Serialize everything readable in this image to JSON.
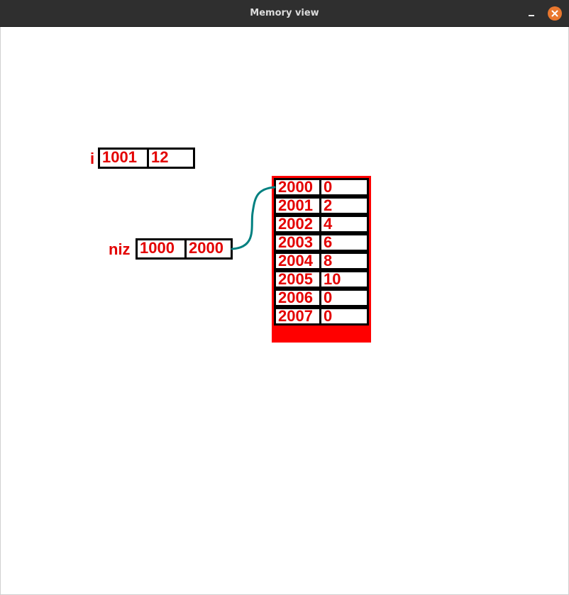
{
  "window": {
    "title": "Memory view",
    "minimize_icon": "minimize-icon",
    "close_icon": "close-icon",
    "close_color": "#e9772e"
  },
  "variables": {
    "i": {
      "name": "i",
      "address": "1001",
      "value": "12"
    },
    "niz": {
      "name": "niz",
      "address": "1000",
      "value": "2000"
    }
  },
  "array": {
    "rows": [
      {
        "address": "2000",
        "value": "0"
      },
      {
        "address": "2001",
        "value": "2"
      },
      {
        "address": "2002",
        "value": "4"
      },
      {
        "address": "2003",
        "value": "6"
      },
      {
        "address": "2004",
        "value": "8"
      },
      {
        "address": "2005",
        "value": "10"
      },
      {
        "address": "2006",
        "value": "0"
      },
      {
        "address": "2007",
        "value": "0"
      }
    ]
  },
  "colors": {
    "text": "#e30000",
    "block": "#ff0000",
    "pointer": "#008080",
    "border": "#000000"
  }
}
